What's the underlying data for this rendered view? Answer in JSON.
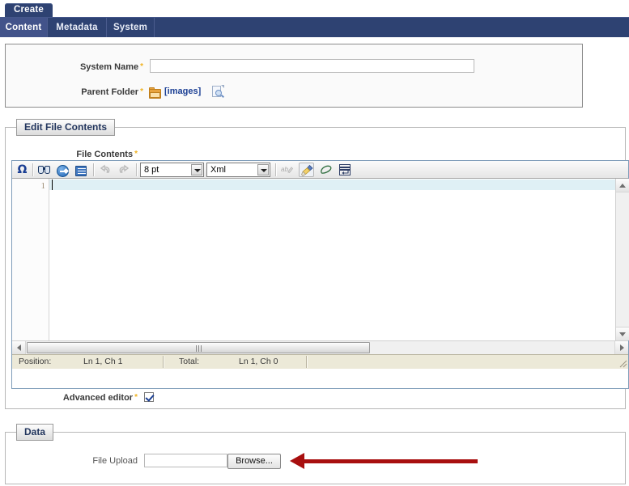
{
  "window": {
    "create_tab_label": "Create"
  },
  "nav": {
    "items": [
      {
        "label": "Content",
        "active": true
      },
      {
        "label": "Metadata",
        "active": false
      },
      {
        "label": "System",
        "active": false
      }
    ]
  },
  "form": {
    "system_name": {
      "label": "System Name",
      "required_marker": "*",
      "value": "",
      "placeholder": ""
    },
    "parent_folder": {
      "label": "Parent Folder",
      "required_marker": "*",
      "value": "[images]",
      "folder_icon": "folder-icon",
      "browse_icon": "page-search-icon"
    }
  },
  "edit_file_contents": {
    "legend": "Edit File Contents",
    "file_contents_label": "File Contents",
    "required_marker": "*",
    "toolbar": {
      "buttons": [
        {
          "name": "special-character-icon",
          "glyph": "Ω",
          "title": "Special character"
        },
        {
          "name": "find-icon",
          "glyph": "binoculars",
          "title": "Find"
        },
        {
          "name": "goto-icon",
          "glyph": "blue-arrow-circle",
          "title": "Go to"
        },
        {
          "name": "insert-block-icon",
          "glyph": "blue-lines-box",
          "title": "Insert block"
        },
        {
          "name": "undo-icon",
          "glyph": "undo-arrow",
          "title": "Undo"
        },
        {
          "name": "redo-icon",
          "glyph": "redo-arrow",
          "title": "Redo"
        },
        {
          "name": "spellcheck-icon",
          "glyph": "ab-pencil",
          "title": "Spell check"
        },
        {
          "name": "format-brush-icon",
          "glyph": "paint-brush",
          "title": "Format"
        },
        {
          "name": "erase-icon",
          "glyph": "eraser",
          "title": "Erase formatting"
        },
        {
          "name": "wrap-icon",
          "glyph": "word-wrap",
          "title": "Word wrap"
        }
      ],
      "font_size": {
        "label": "font-size-select",
        "value": "8 pt"
      },
      "language": {
        "label": "language-select",
        "value": "Xml"
      }
    },
    "editor": {
      "line_numbers": [
        "1"
      ],
      "content": ""
    },
    "status": {
      "position_label": "Position:",
      "position_value": "Ln 1, Ch 1",
      "total_label": "Total:",
      "total_value": "Ln 1, Ch 0"
    },
    "advanced_editor": {
      "label": "Advanced editor",
      "required_marker": "*",
      "checked": true
    }
  },
  "data_section": {
    "legend": "Data",
    "file_upload": {
      "label": "File Upload",
      "value": "",
      "browse_label": "Browse..."
    },
    "annotation": {
      "name": "red-arrow-annotation",
      "color": "#a80f0f",
      "points_to": "Browse... button"
    }
  },
  "colors": {
    "nav_background": "#2e4272",
    "nav_active": "#42538a",
    "legend_text": "#23365e",
    "link": "#1b3f94",
    "required_star": "#f0b323",
    "status_bar": "#ece9d8",
    "current_line": "#dff0f5",
    "annotation": "#a80f0f"
  }
}
